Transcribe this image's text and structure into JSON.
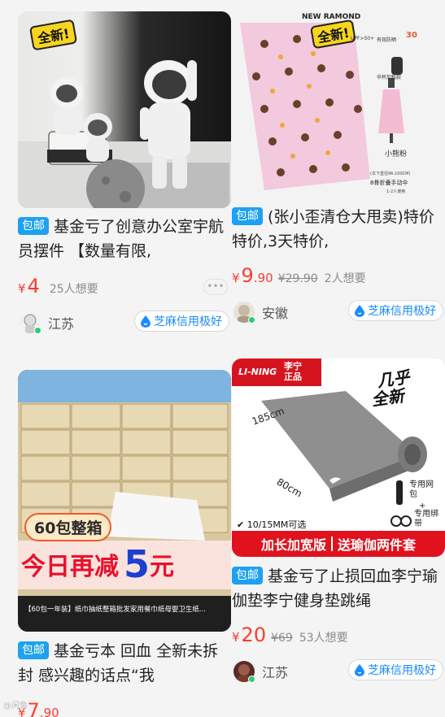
{
  "listings": [
    {
      "badge": "全新!",
      "tag": "包邮",
      "title": "基金亏了创意办公室宇航员摆件 【数量有限,",
      "price_currency": "¥",
      "price_int": "4",
      "price_dec": "",
      "original_price": "",
      "want": "25人想要",
      "more": "•••",
      "location": "江苏",
      "credit": "芝麻信用极好"
    },
    {
      "badge": "全新!",
      "tag": "包邮",
      "title": "(张小歪清仓大甩卖)特价特价,3天特价,",
      "price_currency": "¥",
      "price_int": "9",
      "price_dec": ".90",
      "original_price": "¥29.90",
      "want": "2人想要",
      "location": "安徽",
      "credit": "芝麻信用极好",
      "image_text": {
        "brand": "NEW RAMOND",
        "upf": "UPF>50+",
        "shade": "有效防晒",
        "extra": "伞杯加粗款",
        "small_label": "小熊粉",
        "spec": "(伞下直径96-100CM)",
        "type": "8骨折叠手动伞",
        "usage": "1-2人使用",
        "days": "30"
      }
    },
    {
      "tag": "包邮",
      "title": "基金亏本 回血 全新未拆封 感兴趣的话点“我",
      "price_currency": "¥",
      "price_int": "7",
      "price_dec": ".90",
      "image_text": {
        "pack": "60包整箱",
        "promo": "今日再减",
        "amount": "5",
        "unit": "元",
        "caption": "【60包一年装】纸巾抽纸整箱批发家用餐巾纸母婴卫生纸..."
      }
    },
    {
      "tag": "包邮",
      "title": "基金亏了止损回血李宁瑜伽垫李宁健身垫跳绳",
      "price_currency": "¥",
      "price_int": "20",
      "price_dec": "",
      "original_price": "¥69",
      "want": "53人想要",
      "location": "江苏",
      "credit": "芝麻信用极好",
      "image_text": {
        "brand": "LI-NING",
        "authentic_1": "李宁",
        "authentic_2": "正品",
        "seal_1": "几乎",
        "seal_2": "全新",
        "length": "185cm",
        "width": "80cm",
        "thickness": "✔ 10/15MM可选",
        "gift_1": "专用网包",
        "plus_1": "+",
        "gift_2": "专用绑带",
        "banner_left": "加长加宽版",
        "banner_right": "送瑜伽两件套"
      }
    }
  ],
  "watermark": "@闲鱼",
  "colors": {
    "tag": "#1ea1f2",
    "price": "#ff3b30",
    "credit": "#1a8cff"
  }
}
